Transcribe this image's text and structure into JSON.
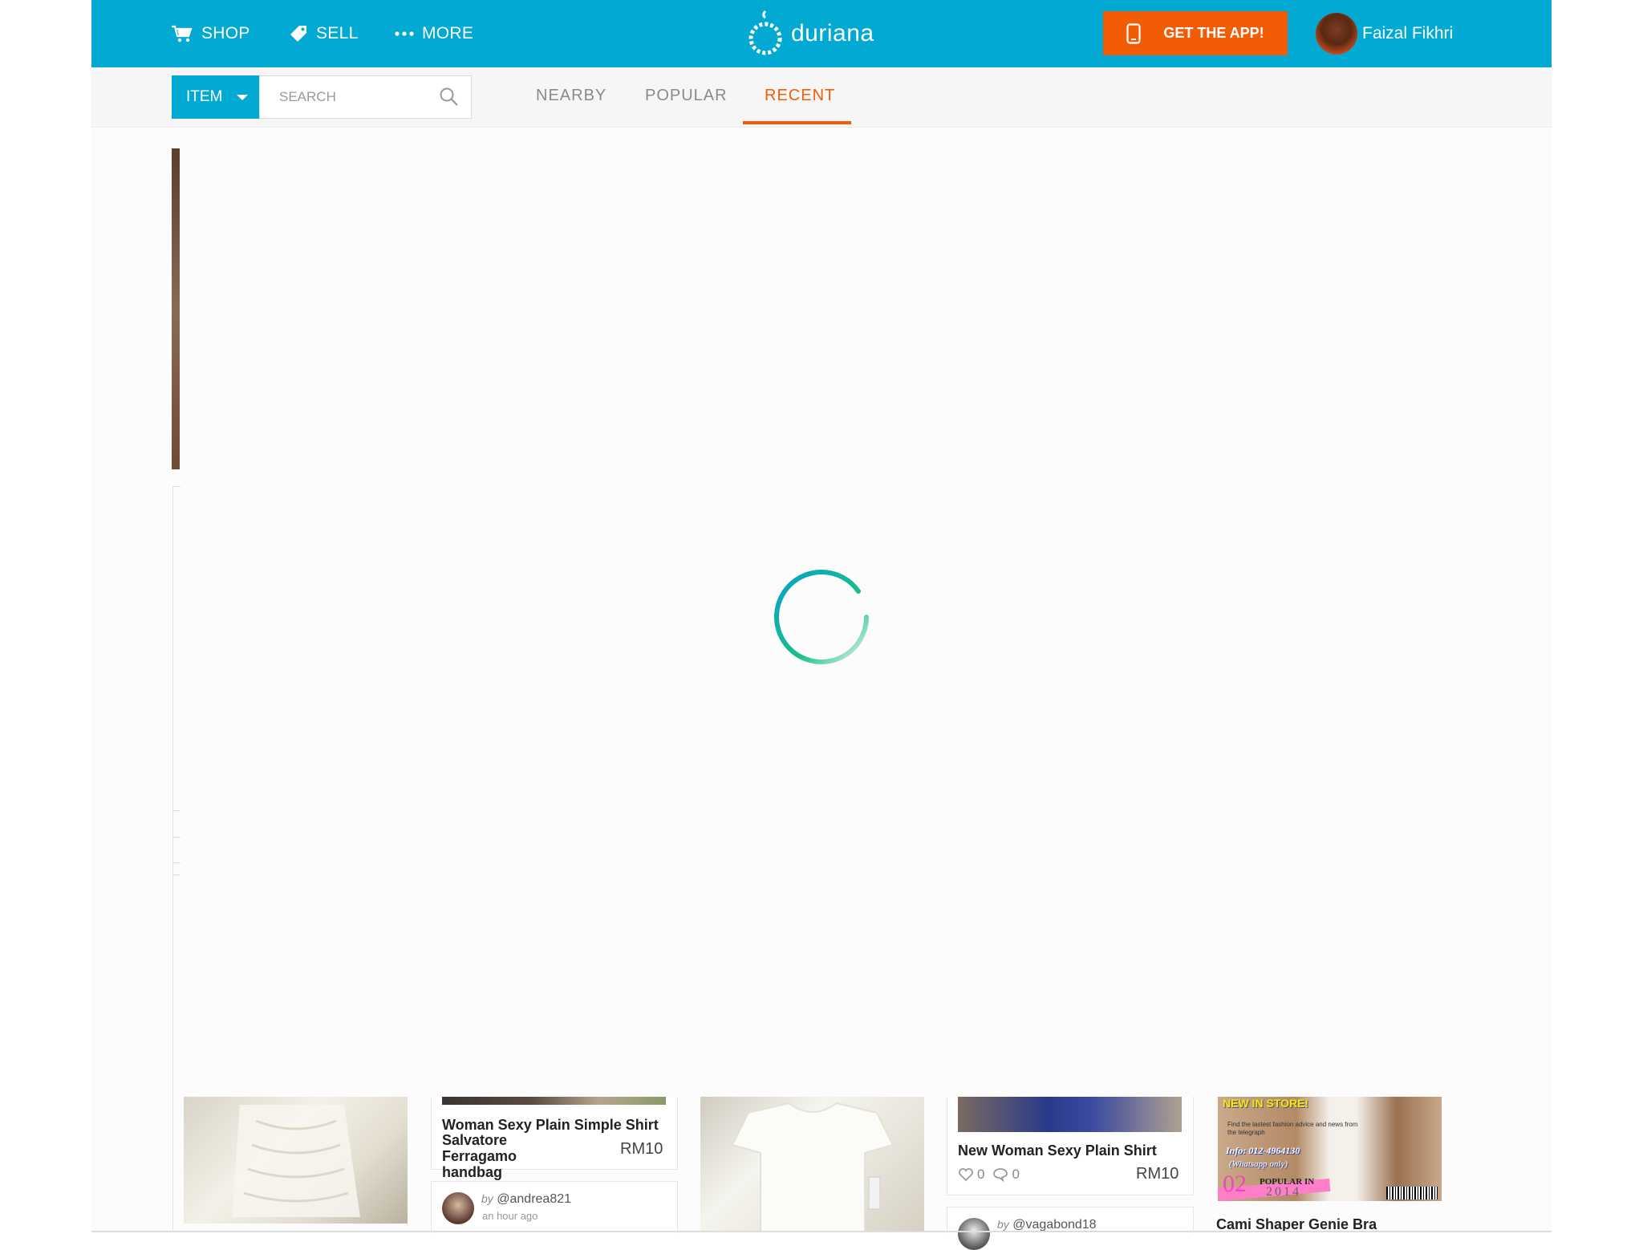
{
  "header": {
    "nav": [
      {
        "label": "SHOP",
        "icon": "cart-icon"
      },
      {
        "label": "SELL",
        "icon": "tag-icon"
      },
      {
        "label": "MORE",
        "icon": "more-dots-icon"
      }
    ],
    "logo_text": "duriana",
    "get_app_label": "GET THE APP!",
    "user_name": "Faizal Fikhri"
  },
  "search": {
    "category": "ITEM",
    "placeholder": "SEARCH"
  },
  "tabs": [
    {
      "label": "NEARBY",
      "active": false
    },
    {
      "label": "POPULAR",
      "active": false
    },
    {
      "label": "RECENT",
      "active": true
    }
  ],
  "colors": {
    "brand": "#02a9d3",
    "accent": "#f25c05",
    "spinner": "#1bbf8a"
  },
  "cards": [
    {
      "title": "Woman Sexy Plain Simple Shirt",
      "price": "RM10",
      "overlap_title": "Salvatore Ferragamo handbag",
      "user": "@andrea821",
      "time": "an hour ago"
    },
    {
      "title": "New Woman Sexy Plain Shirt",
      "price": "RM10",
      "likes": "0",
      "comments": "0",
      "user": "@vagabond18"
    },
    {
      "title": "Cami Shaper Genie Bra",
      "ad_headline": "NEW IN STORE!",
      "ad_text": "Find the lastest fashion advice and news from the telegraph",
      "ad_phone": "Info: 012-4964130",
      "ad_note": "(Whatsapp only)",
      "ad_issue": "02",
      "ad_year": "2014",
      "ad_tag": "POPULAR IN"
    }
  ],
  "status": {
    "by_prefix": "by"
  }
}
